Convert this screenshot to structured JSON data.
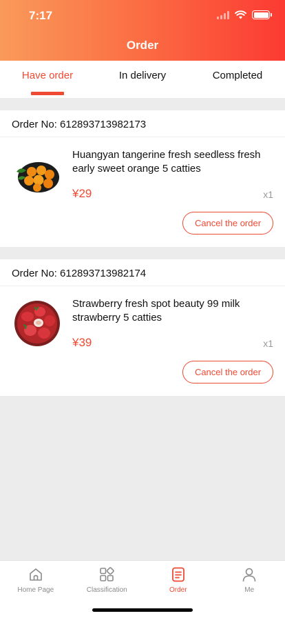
{
  "status_bar": {
    "time": "7:17"
  },
  "header": {
    "title": "Order"
  },
  "tabs": [
    {
      "label": "Have order",
      "active": true
    },
    {
      "label": "In delivery",
      "active": false
    },
    {
      "label": "Completed",
      "active": false
    }
  ],
  "orders": [
    {
      "order_no": "Order No: 612893713982173",
      "product_name": "Huangyan tangerine fresh seedless fresh early sweet orange 5 catties",
      "price": "¥29",
      "quantity": "x1",
      "cancel_label": "Cancel the order",
      "image": "tangerines-plate"
    },
    {
      "order_no": "Order No: 612893713982174",
      "product_name": "Strawberry fresh spot beauty 99 milk strawberry 5 catties",
      "price": "¥39",
      "quantity": "x1",
      "cancel_label": "Cancel the order",
      "image": "strawberries-bowl"
    }
  ],
  "tabbar": [
    {
      "label": "Home Page",
      "icon": "home-icon",
      "active": false
    },
    {
      "label": "Classification",
      "icon": "grid-icon",
      "active": false
    },
    {
      "label": "Order",
      "icon": "order-icon",
      "active": true
    },
    {
      "label": "Me",
      "icon": "person-icon",
      "active": false
    }
  ],
  "colors": {
    "accent": "#ef4a33",
    "header_start": "#fa9a5a",
    "header_end": "#fc3a32"
  }
}
